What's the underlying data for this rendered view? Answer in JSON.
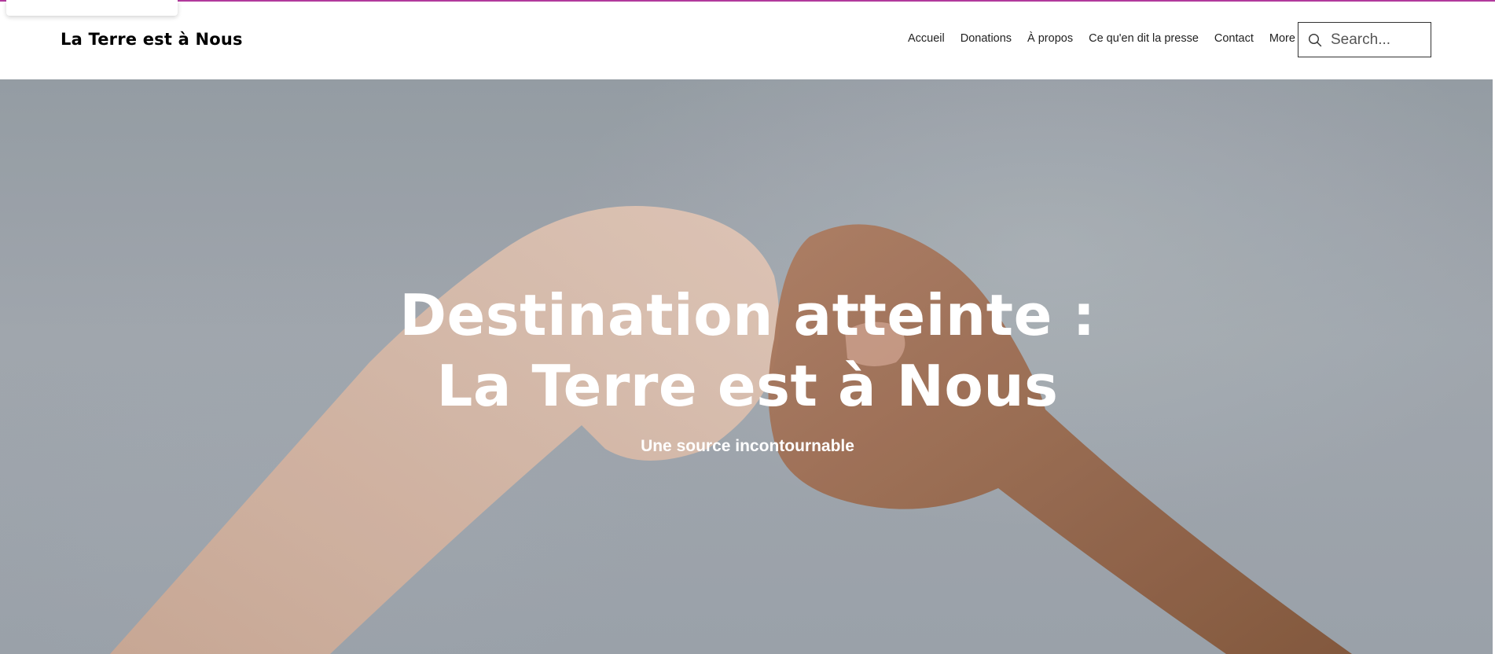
{
  "header": {
    "site_title": "La Terre est à Nous"
  },
  "nav": {
    "items": [
      {
        "label": "Accueil"
      },
      {
        "label": "Donations"
      },
      {
        "label": "À propos"
      },
      {
        "label": "Ce qu'en dit la presse"
      },
      {
        "label": "Contact"
      },
      {
        "label": "More"
      }
    ]
  },
  "search": {
    "placeholder": "Search...",
    "icon": "search-icon"
  },
  "hero": {
    "title_line_1": "Destination atteinte :",
    "title_line_2": "La Terre est à Nous",
    "subtitle": "Une source incontournable"
  },
  "colors": {
    "accent": "#b13a9c",
    "header_bg": "#ffffff",
    "hero_bg": "#a4acb4",
    "hero_text": "#ffffff"
  }
}
